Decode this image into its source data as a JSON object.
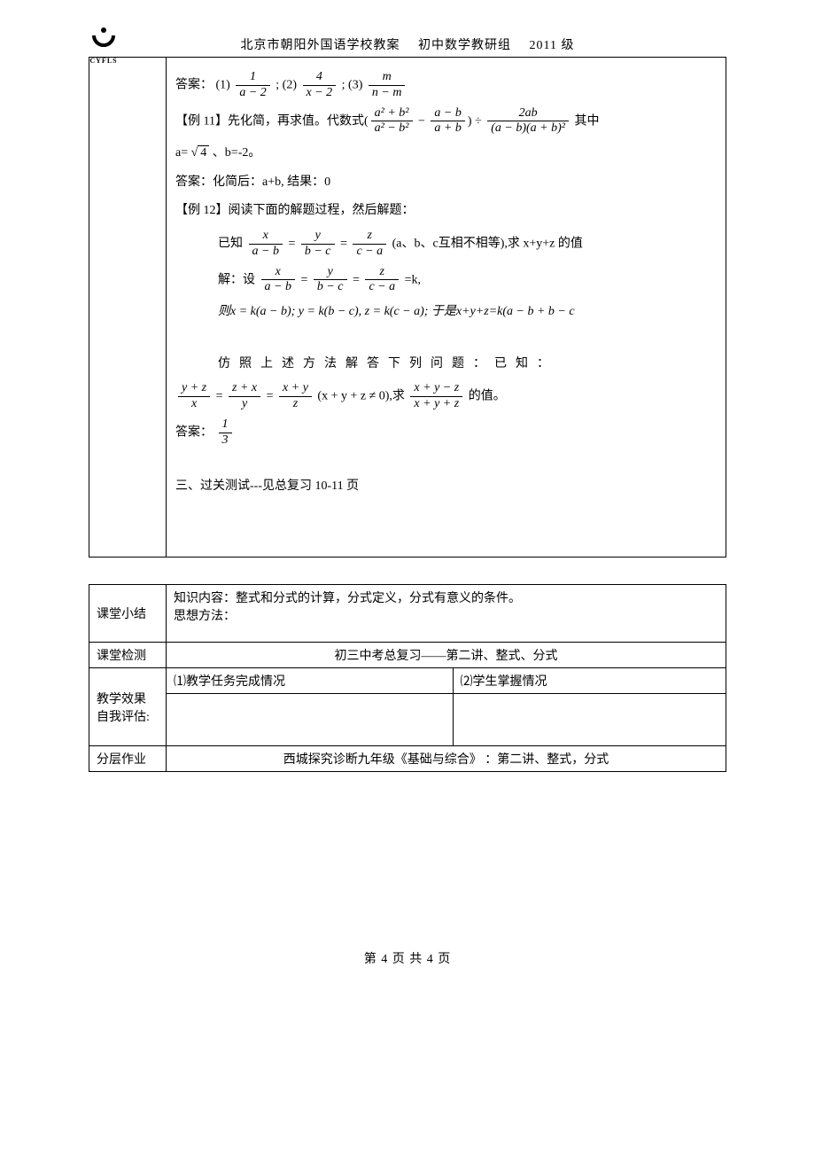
{
  "header": {
    "school": "北京市朝阳外国语学校教案",
    "dept": "初中数学教研组",
    "year": "2011 级",
    "logo_label": "CYFLS"
  },
  "table1": {
    "answer_prefix": "答案：",
    "ans1_label": "(1)",
    "ans1_num": "1",
    "ans1_den": "a − 2",
    "ans2_label": "; (2)",
    "ans2_num": "4",
    "ans2_den": "x − 2",
    "ans3_label": "; (3)",
    "ans3_num": "m",
    "ans3_den": "n − m",
    "ex11_label": "【例 11】",
    "ex11_text1": "先化简，再求值。代数式",
    "ex11_frA_num": "a² + b²",
    "ex11_frA_den": "a² − b²",
    "ex11_minus": "−",
    "ex11_frB_num": "a − b",
    "ex11_frB_den": "a + b",
    "ex11_div": "÷",
    "ex11_frC_num": "2ab",
    "ex11_frC_den": "(a − b)(a + b)²",
    "ex11_text2": "其中",
    "ex11_cond": "a= ",
    "ex11_sqrt": "4",
    "ex11_cond2": "、b=-2。",
    "ex11_ans": "答案：化简后：a+b,   结果：0",
    "ex12_label": "【例 12】",
    "ex12_text": "阅读下面的解题过程，然后解题：",
    "ex12_given": "已知",
    "ex12_f1_num": "x",
    "ex12_f1_den": "a − b",
    "ex12_eq": "=",
    "ex12_f2_num": "y",
    "ex12_f2_den": "b − c",
    "ex12_f3_num": "z",
    "ex12_f3_den": "c − a",
    "ex12_given2": "(a、b、c互相不相等),求 x+y+z 的值",
    "ex12_sol1": "解：设",
    "ex12_k": "=k,",
    "ex12_sol2": "则x = k(a − b);  y = k(b − c), z = k(c − a); 于是x+y+z=k(a − b + b − c",
    "ex12_follow": "仿照上述方法解答下列问题：已知：",
    "ex12_q1_num": "y + z",
    "ex12_q1_den": "x",
    "ex12_q2_num": "z + x",
    "ex12_q2_den": "y",
    "ex12_q3_num": "x + y",
    "ex12_q3_den": "z",
    "ex12_cond_neq": "(x + y + z ≠ 0),求",
    "ex12_q4_num": "x + y − z",
    "ex12_q4_den": "x + y + z",
    "ex12_end": "的值。",
    "ex12_ans_prefix": "答案：",
    "ex12_ans_num": "1",
    "ex12_ans_den": "3",
    "section3": "三、过关测试---见总复习 10-11 页"
  },
  "table2": {
    "r1_label": "课堂小结",
    "r1_line1": "知识内容：整式和分式的计算，分式定义，分式有意义的条件。",
    "r1_line2": "思想方法：",
    "r2_label": "课堂检测",
    "r2_text": "初三中考总复习——第二讲、整式、分式",
    "r3_label": "教学效果\n自我评估:",
    "r3_c1": "⑴教学任务完成情况",
    "r3_c2": "⑵学生掌握情况",
    "r4_label": "分层作业",
    "r4_text": "西城探究诊断九年级《基础与综合》 ：第二讲、整式，分式"
  },
  "footer": "第 4 页 共 4 页"
}
